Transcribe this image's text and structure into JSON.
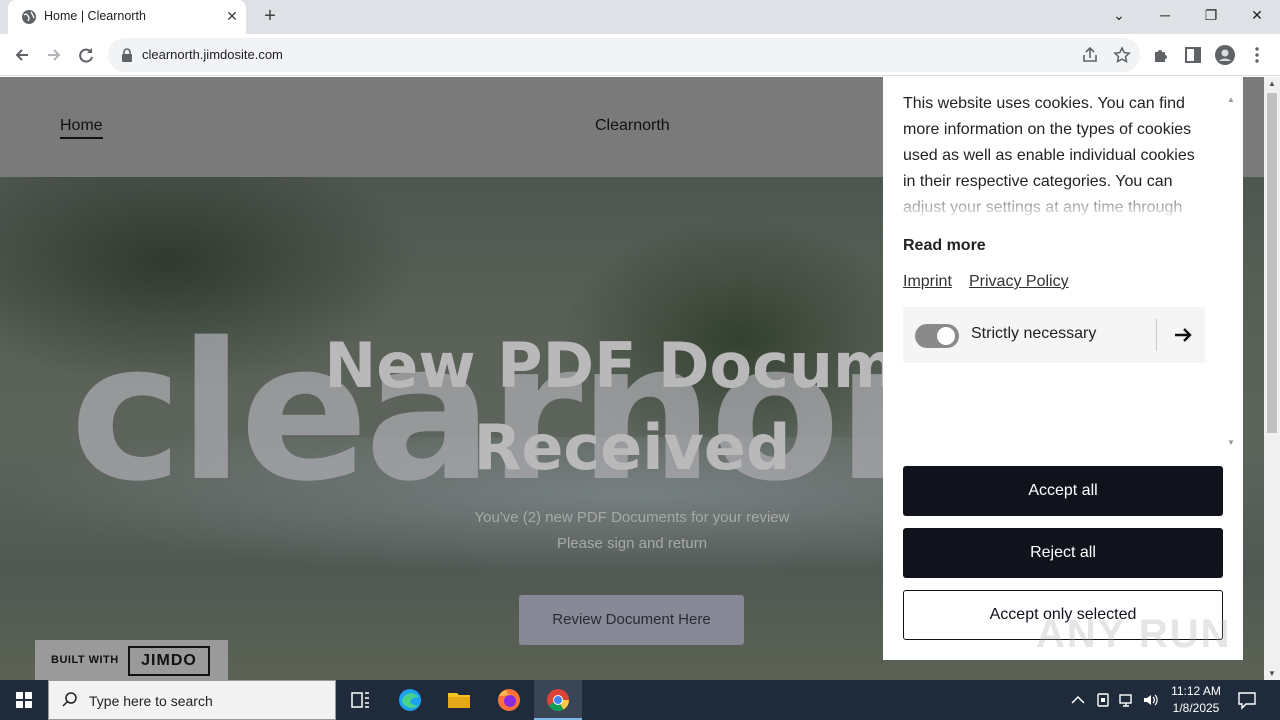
{
  "browser": {
    "tab_title": "Home | Clearnorth",
    "url": "clearnorth.jimdosite.com",
    "controls": {
      "tab_close": "✕",
      "new_tab": "+",
      "tab_search": "⌄",
      "minimize": "─",
      "restore": "❐",
      "close": "✕"
    }
  },
  "site": {
    "nav_home": "Home",
    "brand": "Clearnorth",
    "sign_text": "clearnort",
    "hero_title_line1": "New PDF Docume",
    "hero_title_line2": "Received",
    "hero_sub_line1": "You've (2) new PDF Documents for your review",
    "hero_sub_line2": "Please sign and return",
    "review_button": "Review Document Here",
    "badge_built_with": "BUILT WITH",
    "badge_logo": "JIMDO"
  },
  "cookie": {
    "description": "This website uses cookies. You can find more information on the types of cookies used as well as enable individual cookies in their respective categories. You can adjust your settings at any time through",
    "read_more": "Read more",
    "imprint": "Imprint",
    "privacy_policy": "Privacy Policy",
    "category_label": "Strictly necessary",
    "category_toggle_on": true,
    "accept_all": "Accept all",
    "reject_all": "Reject all",
    "accept_selected": "Accept only selected"
  },
  "watermark": "ANY RUN",
  "taskbar": {
    "search_placeholder": "Type here to search",
    "time": "11:12 AM",
    "date": "1/8/2025"
  },
  "colors": {
    "cookie_button_dark": "#10131c",
    "review_button": "#878a96",
    "taskbar": "#1f2b3a"
  }
}
